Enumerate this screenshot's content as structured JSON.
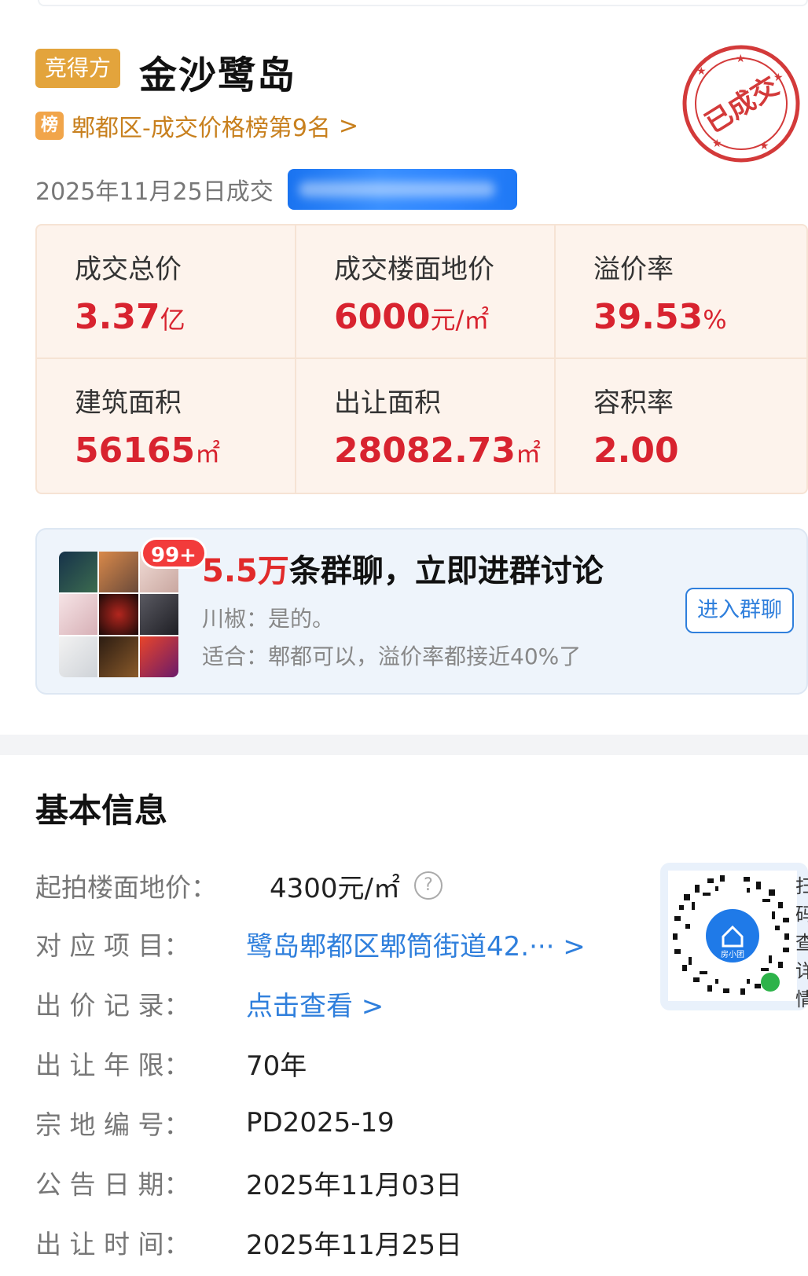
{
  "header": {
    "tag": "竞得方",
    "title": "金沙鹭岛",
    "rank_badge": "榜",
    "rank_text": "郫都区-成交价格榜第9名",
    "rank_arrow": ">",
    "deal_date": "2025年11月25日成交",
    "stamp_text": "已成交"
  },
  "stats": [
    {
      "label": "成交总价",
      "value": "3.37",
      "unit": "亿"
    },
    {
      "label": "成交楼面地价",
      "value": "6000",
      "unit": "元/㎡"
    },
    {
      "label": "溢价率",
      "value": "39.53",
      "unit": "%"
    },
    {
      "label": "建筑面积",
      "value": "56165",
      "unit": "㎡"
    },
    {
      "label": "出让面积",
      "value": "28082.73",
      "unit": "㎡"
    },
    {
      "label": "容积率",
      "value": "2.00",
      "unit": ""
    }
  ],
  "group": {
    "badge": "99+",
    "title_highlight": "5.5万",
    "title_rest": "条群聊，立即进群讨论",
    "msg1": "川椒：是的。",
    "msg2": "适合：郫都可以，溢价率都接近40%了",
    "join_label": "进入群聊"
  },
  "basic": {
    "title": "基本信息",
    "rows": [
      {
        "label": "起拍楼面地价：",
        "value": "4300元/㎡"
      },
      {
        "label": "对 应 项 目：",
        "value": "鹭岛郫都区郫筒街道42.··· >"
      },
      {
        "label": "出 价 记 录：",
        "value": "点击查看 >"
      },
      {
        "label": "出 让 年 限：",
        "value": "70年"
      },
      {
        "label": "宗 地 编 号：",
        "value": "PD2025-19"
      },
      {
        "label": "公 告 日 期：",
        "value": "2025年11月03日"
      },
      {
        "label": "出 让 时 间：",
        "value": "2025年11月25日"
      }
    ],
    "help_icon": "?",
    "qr_logo_text": "房小团",
    "qr_side_text": "扫码查详情"
  },
  "colors": {
    "accent_red": "#d8232f",
    "link_blue": "#2f7fdc",
    "tag_gold": "#e3a43c",
    "stamp_red": "#d33a3a"
  }
}
